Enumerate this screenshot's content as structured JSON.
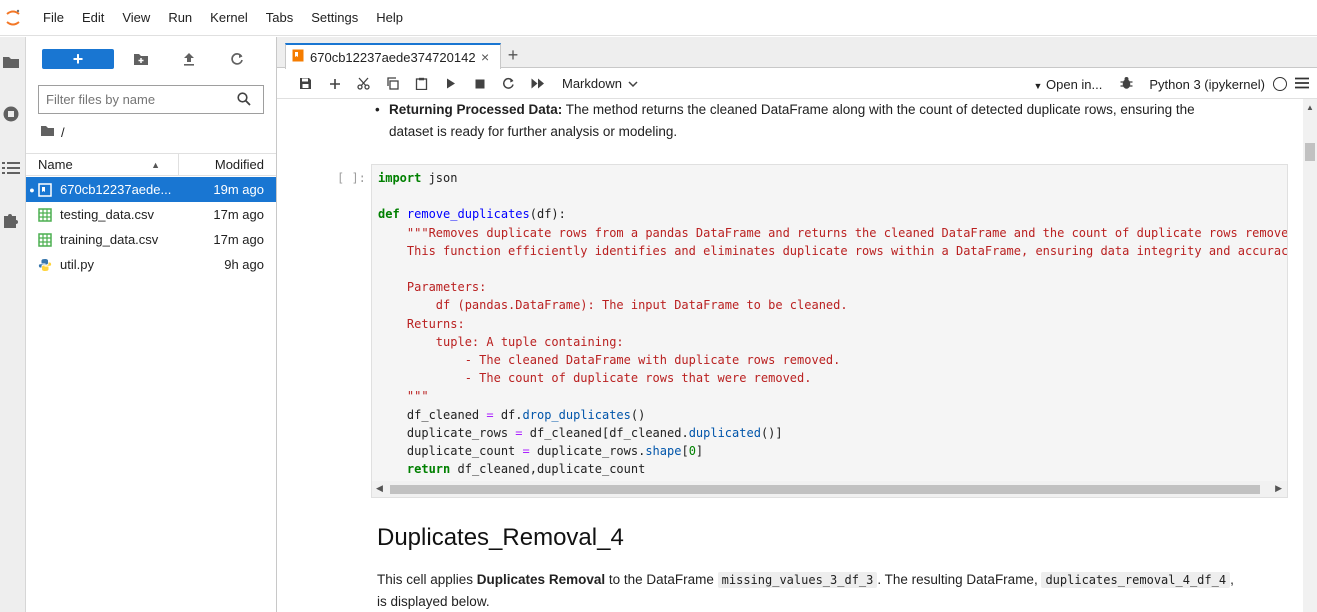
{
  "menu": {
    "items": [
      "File",
      "Edit",
      "View",
      "Run",
      "Kernel",
      "Tabs",
      "Settings",
      "Help"
    ]
  },
  "filebrowser": {
    "new_label": "+",
    "filter_placeholder": "Filter files by name",
    "breadcrumb": "/",
    "col_name": "Name",
    "col_modified": "Modified",
    "files": [
      {
        "name": "670cb12237aede...",
        "modified": "19m ago",
        "icon": "notebook-icon",
        "selected": true
      },
      {
        "name": "testing_data.csv",
        "modified": "17m ago",
        "icon": "spreadsheet-icon",
        "selected": false
      },
      {
        "name": "training_data.csv",
        "modified": "17m ago",
        "icon": "spreadsheet-icon",
        "selected": false
      },
      {
        "name": "util.py",
        "modified": "9h ago",
        "icon": "python-icon",
        "selected": false
      }
    ]
  },
  "tab": {
    "title": "670cb12237aede374720142",
    "close": "×",
    "add": "+"
  },
  "toolbar": {
    "cell_type": "Markdown",
    "open_in": "Open in...",
    "kernel": "Python 3 (ipykernel)"
  },
  "notebook": {
    "bullet_bold": "Returning Processed Data:",
    "bullet_text": " The method returns the cleaned DataFrame along with the count of detected duplicate rows, ensuring the dataset is ready for further analysis or modeling.",
    "prompt": "[ ]:",
    "heading": "Duplicates_Removal_4",
    "para_1": "This cell applies ",
    "para_bold": "Duplicates Removal",
    "para_2": " to the DataFrame ",
    "para_code_1": "missing_values_3_df_3",
    "para_3": ". The resulting DataFrame, ",
    "para_code_2": "duplicates_removal_4_df_4",
    "para_4": ",",
    "para_5": "is displayed below."
  },
  "colors": {
    "accent": "#1976d2",
    "keyword": "#008000",
    "string": "#ba2121",
    "function": "#0000ff"
  }
}
